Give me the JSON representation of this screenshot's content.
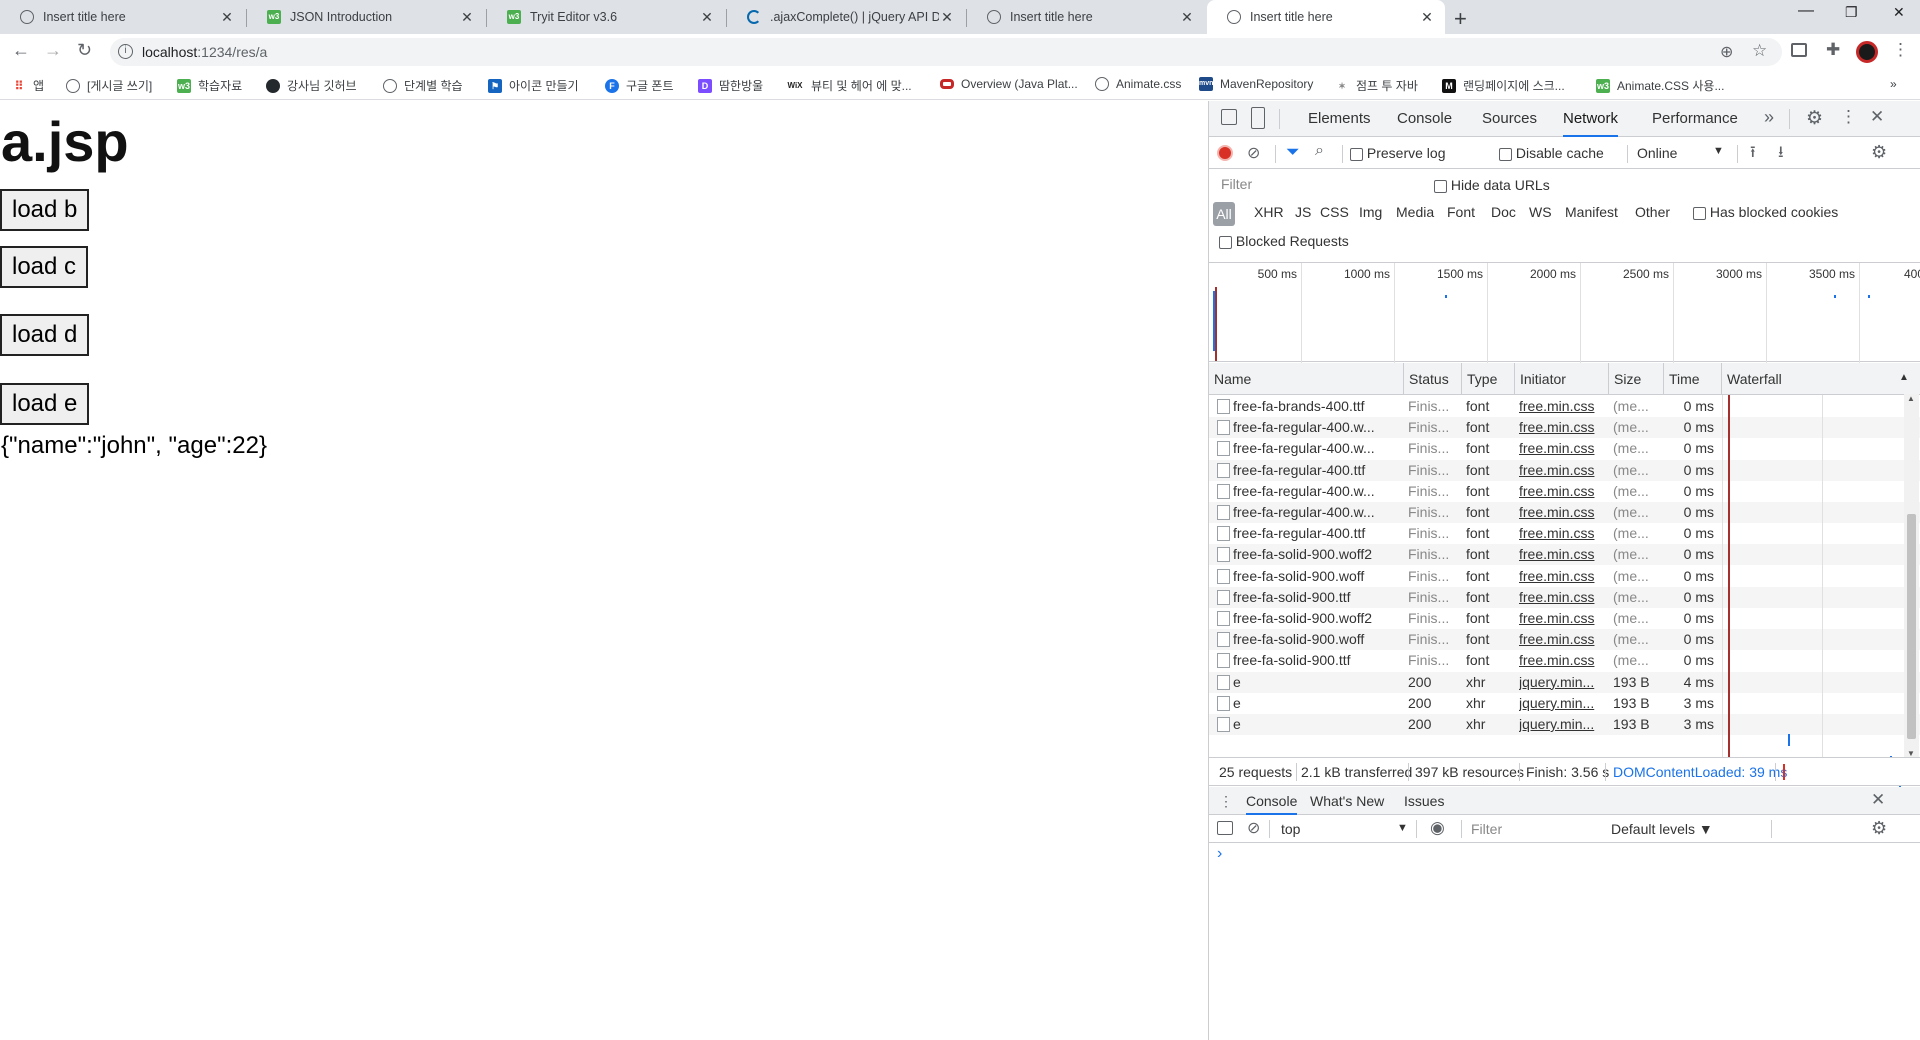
{
  "browser": {
    "tabs": [
      {
        "title": "Insert title here",
        "icon": "globe-icon",
        "active": false
      },
      {
        "title": "JSON Introduction",
        "icon": "w3schools-icon",
        "active": false
      },
      {
        "title": "Tryit Editor v3.6",
        "icon": "w3schools-icon",
        "active": false
      },
      {
        "title": ".ajaxComplete() | jQuery API Do",
        "icon": "jquery-icon",
        "active": false
      },
      {
        "title": "Insert title here",
        "icon": "globe-icon",
        "active": false
      },
      {
        "title": "Insert title here",
        "icon": "globe-icon",
        "active": true
      }
    ],
    "url_host": "localhost",
    "url_rest": ":1234/res/a",
    "bookmarks": [
      {
        "label": "앱",
        "color": "#ea4335"
      },
      {
        "label": "[게시글 쓰기]",
        "color": "#5f6368"
      },
      {
        "label": "학습자료",
        "color": "#4caf50"
      },
      {
        "label": "강사님 깃허브",
        "color": "#24292e"
      },
      {
        "label": "단계별 학습",
        "color": "#5f6368"
      },
      {
        "label": "아이콘 만들기",
        "color": "#1565c0"
      },
      {
        "label": "구글 폰트",
        "color": "#1a73e8"
      },
      {
        "label": "땀한방울",
        "color": "#7c4dff"
      },
      {
        "label": "뷰티 및 헤어 에 맞...",
        "color": "#222222"
      },
      {
        "label": "Overview (Java Plat...",
        "color": "#c62828"
      },
      {
        "label": "Animate.css",
        "color": "#5f6368"
      },
      {
        "label": "MavenRepository",
        "color": "#1e4a8a"
      },
      {
        "label": "점프 투 자바",
        "color": "#888888"
      },
      {
        "label": "랜딩페이지에 스크...",
        "color": "#111111"
      },
      {
        "label": "Animate.CSS 사용...",
        "color": "#4caf50"
      }
    ]
  },
  "page": {
    "heading": "a.jsp",
    "buttons": [
      "load b",
      "load c",
      "load d",
      "load e"
    ],
    "output": "{\"name\":\"john\", \"age\":22}"
  },
  "devtools": {
    "tabs": [
      "Elements",
      "Console",
      "Sources",
      "Network",
      "Performance"
    ],
    "selected_tab": "Network",
    "preserve_log": "Preserve log",
    "disable_cache": "Disable cache",
    "throttle": "Online",
    "filter_placeholder": "Filter",
    "hide_data_urls": "Hide data URLs",
    "type_filters": [
      "All",
      "XHR",
      "JS",
      "CSS",
      "Img",
      "Media",
      "Font",
      "Doc",
      "WS",
      "Manifest",
      "Other"
    ],
    "has_blocked_cookies": "Has blocked cookies",
    "blocked_requests": "Blocked Requests",
    "overview_ticks": [
      "500 ms",
      "1000 ms",
      "1500 ms",
      "2000 ms",
      "2500 ms",
      "3000 ms",
      "3500 ms",
      "400"
    ],
    "columns": [
      "Name",
      "Status",
      "Type",
      "Initiator",
      "Size",
      "Time",
      "Waterfall"
    ],
    "rows": [
      {
        "name": "free-fa-brands-400.ttf",
        "status": "Finis...",
        "type": "font",
        "initiator": "free.min.css",
        "size": "(me...",
        "time": "0 ms"
      },
      {
        "name": "free-fa-regular-400.w...",
        "status": "Finis...",
        "type": "font",
        "initiator": "free.min.css",
        "size": "(me...",
        "time": "0 ms"
      },
      {
        "name": "free-fa-regular-400.w...",
        "status": "Finis...",
        "type": "font",
        "initiator": "free.min.css",
        "size": "(me...",
        "time": "0 ms"
      },
      {
        "name": "free-fa-regular-400.ttf",
        "status": "Finis...",
        "type": "font",
        "initiator": "free.min.css",
        "size": "(me...",
        "time": "0 ms"
      },
      {
        "name": "free-fa-regular-400.w...",
        "status": "Finis...",
        "type": "font",
        "initiator": "free.min.css",
        "size": "(me...",
        "time": "0 ms"
      },
      {
        "name": "free-fa-regular-400.w...",
        "status": "Finis...",
        "type": "font",
        "initiator": "free.min.css",
        "size": "(me...",
        "time": "0 ms"
      },
      {
        "name": "free-fa-regular-400.ttf",
        "status": "Finis...",
        "type": "font",
        "initiator": "free.min.css",
        "size": "(me...",
        "time": "0 ms"
      },
      {
        "name": "free-fa-solid-900.woff2",
        "status": "Finis...",
        "type": "font",
        "initiator": "free.min.css",
        "size": "(me...",
        "time": "0 ms"
      },
      {
        "name": "free-fa-solid-900.woff",
        "status": "Finis...",
        "type": "font",
        "initiator": "free.min.css",
        "size": "(me...",
        "time": "0 ms"
      },
      {
        "name": "free-fa-solid-900.ttf",
        "status": "Finis...",
        "type": "font",
        "initiator": "free.min.css",
        "size": "(me...",
        "time": "0 ms"
      },
      {
        "name": "free-fa-solid-900.woff2",
        "status": "Finis...",
        "type": "font",
        "initiator": "free.min.css",
        "size": "(me...",
        "time": "0 ms"
      },
      {
        "name": "free-fa-solid-900.woff",
        "status": "Finis...",
        "type": "font",
        "initiator": "free.min.css",
        "size": "(me...",
        "time": "0 ms"
      },
      {
        "name": "free-fa-solid-900.ttf",
        "status": "Finis...",
        "type": "font",
        "initiator": "free.min.css",
        "size": "(me...",
        "time": "0 ms"
      },
      {
        "name": "e",
        "status": "200",
        "type": "xhr",
        "initiator": "jquery.min...",
        "size": "193 B",
        "time": "4 ms"
      },
      {
        "name": "e",
        "status": "200",
        "type": "xhr",
        "initiator": "jquery.min...",
        "size": "193 B",
        "time": "3 ms"
      },
      {
        "name": "e",
        "status": "200",
        "type": "xhr",
        "initiator": "jquery.min...",
        "size": "193 B",
        "time": "3 ms"
      }
    ],
    "summary": {
      "requests": "25 requests",
      "transferred": "2.1 kB transferred",
      "resources": "397 kB resources",
      "finish": "Finish: 3.56 s",
      "dom_content_loaded": "DOMContentLoaded: 39 ms"
    },
    "drawer_tabs": [
      "Console",
      "What's New",
      "Issues"
    ],
    "console_context": "top",
    "console_filter_placeholder": "Filter",
    "console_levels": "Default levels ▼",
    "prompt": "›",
    "colors": {
      "accent": "#1a73e8",
      "record": "#d93025",
      "dcl": "#1a73e8"
    }
  }
}
